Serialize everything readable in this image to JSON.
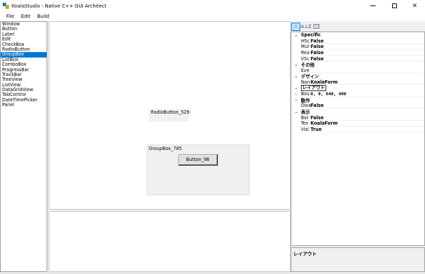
{
  "window": {
    "title": "KoalaStudio - Native C++ GUI Architect"
  },
  "menu": [
    "File",
    "Edit",
    "Build"
  ],
  "toolbox": {
    "items": [
      "Window",
      "Button",
      "Label",
      "Edit",
      "CheckBox",
      "RadioButton",
      "GroupBox",
      "ListBox",
      "ComboBox",
      "ProgressBar",
      "TrackBar",
      "TreeView",
      "ListView",
      "DataGridView",
      "TabControl",
      "DateTimePicker",
      "Panel"
    ],
    "selected": "GroupBox"
  },
  "designer": {
    "radio_label": "RadioButton_529",
    "group_label": "GroupBox_785",
    "button_label": "Button_96"
  },
  "properties": {
    "toolbar": {
      "categorized": "⁝⁝",
      "alphabetical": "A↓Z"
    },
    "categories": [
      {
        "name": "Specific",
        "expanded": true,
        "rows": [
          {
            "name": "HSc",
            "value": "False"
          },
          {
            "name": "Mul",
            "value": "False"
          },
          {
            "name": "Rea",
            "value": "False"
          },
          {
            "name": "VSc",
            "value": "False"
          }
        ]
      },
      {
        "name": "その他",
        "expanded": true,
        "rows": [
          {
            "name": "Eve",
            "value": ""
          }
        ]
      },
      {
        "name": "デザイン",
        "expanded": true,
        "rows": [
          {
            "name": "Nan",
            "value": "KoalaForm"
          }
        ]
      },
      {
        "name": "レイアウト",
        "expanded": true,
        "highlight": true,
        "rows": [
          {
            "name": "Bou",
            "value": "0, 0, 640, 480",
            "collapsed": true
          }
        ]
      },
      {
        "name": "動作",
        "expanded": true,
        "rows": [
          {
            "name": "Disa",
            "value": "False"
          }
        ]
      },
      {
        "name": "表示",
        "expanded": true,
        "rows": [
          {
            "name": "Bor",
            "value": "False"
          },
          {
            "name": "Tex",
            "value": "KoalaForm"
          },
          {
            "name": "Visi",
            "value": "True"
          }
        ]
      }
    ],
    "description_title": "レイアウト"
  }
}
